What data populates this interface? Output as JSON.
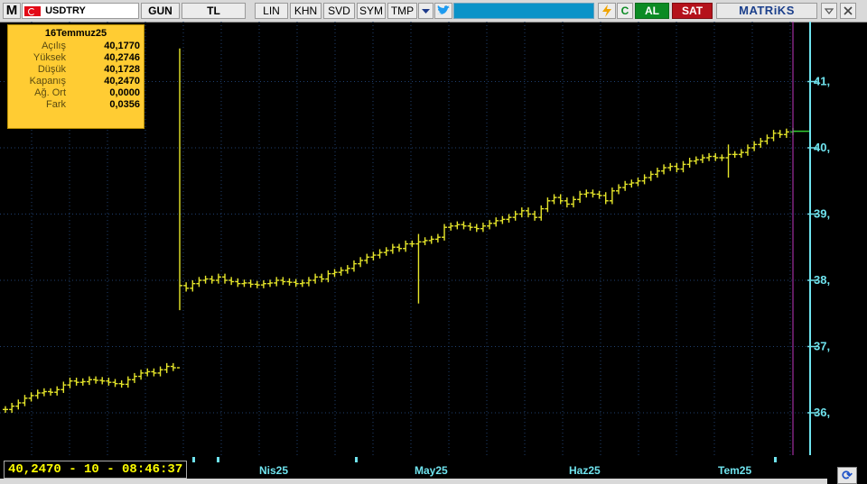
{
  "toolbar": {
    "app_letter": "M",
    "symbol": "USDTRY",
    "buttons": [
      "GUN",
      "TL",
      "LIN",
      "KHN",
      "SVD",
      "SYM",
      "TMP"
    ],
    "buy_label": "AL",
    "sell_label": "SAT",
    "brand": "MATRiKS",
    "icons": [
      "dropdown-arrow-icon",
      "twitter-icon",
      "flash-icon",
      "refresh-c-icon",
      "minimize-icon",
      "close-icon"
    ]
  },
  "info_box": {
    "date": "16Temmuz25",
    "rows": [
      {
        "label": "Açılış",
        "value": "40,1770"
      },
      {
        "label": "Yüksek",
        "value": "40,2746"
      },
      {
        "label": "Düşük",
        "value": "40,1728"
      },
      {
        "label": "Kapanış",
        "value": "40,2470"
      },
      {
        "label": "Ağ. Ort",
        "value": "0,0000"
      },
      {
        "label": "Fark",
        "value": "0,0356"
      }
    ]
  },
  "status": {
    "readout": "40,2470 - 10 - 08:46:37"
  },
  "colors": {
    "bars": "#e6e62a",
    "last_bar": "#33cc33",
    "axis": "#6fe3ee",
    "cursor": "#c238c2",
    "grid": "#1f3f6e"
  },
  "chart_data": {
    "type": "line",
    "title": "",
    "style": "ohlc-bars",
    "yaxis_side": "right",
    "ylim": [
      35.5,
      41.6
    ],
    "y_ticks": [
      36,
      37,
      38,
      39,
      40,
      41
    ],
    "y_tick_labels": [
      "36,",
      "37,",
      "38,",
      "39,",
      "40,",
      "41,"
    ],
    "x_tick_labels": [
      "Nis25",
      "May25",
      "Haz25",
      "Tem25"
    ],
    "grid": true,
    "series": [
      {
        "values": [
          36.05,
          36.1,
          36.15,
          36.22,
          36.26,
          36.3,
          36.32,
          36.31,
          36.35,
          36.42,
          36.48,
          36.46,
          36.47,
          36.5,
          36.49,
          36.48,
          36.46,
          36.44,
          36.43,
          36.5,
          36.55,
          36.6,
          36.62,
          36.6,
          36.65,
          36.7,
          36.68,
          37.92,
          37.88,
          37.95,
          38.0,
          38.02,
          38.0,
          38.05,
          38.0,
          37.98,
          37.95,
          37.96,
          37.94,
          37.93,
          37.95,
          37.96,
          38.0,
          37.98,
          37.97,
          37.95,
          37.96,
          38.0,
          38.05,
          38.02,
          38.1,
          38.12,
          38.15,
          38.18,
          38.25,
          38.3,
          38.35,
          38.38,
          38.42,
          38.45,
          38.5,
          38.48,
          38.55,
          38.55,
          38.58,
          38.6,
          38.62,
          38.65,
          38.8,
          38.82,
          38.84,
          38.82,
          38.8,
          38.78,
          38.82,
          38.86,
          38.9,
          38.92,
          38.95,
          39.0,
          39.05,
          39.0,
          38.95,
          39.08,
          39.2,
          39.25,
          39.2,
          39.15,
          39.22,
          39.3,
          39.32,
          39.3,
          39.28,
          39.2,
          39.35,
          39.4,
          39.45,
          39.47,
          39.5,
          39.55,
          39.6,
          39.65,
          39.7,
          39.72,
          39.68,
          39.75,
          39.8,
          39.82,
          39.85,
          39.87,
          39.85,
          39.85,
          39.9,
          39.9,
          39.93,
          40.0,
          40.05,
          40.1,
          40.15,
          40.22,
          40.2,
          40.24,
          40.25
        ],
        "markers": [
          {
            "index": 27,
            "low": 37.55,
            "high": 41.5
          },
          {
            "index": 64,
            "low": 37.65,
            "high": 38.7
          },
          {
            "index": 112,
            "low": 39.55,
            "high": 40.05
          }
        ]
      }
    ]
  }
}
